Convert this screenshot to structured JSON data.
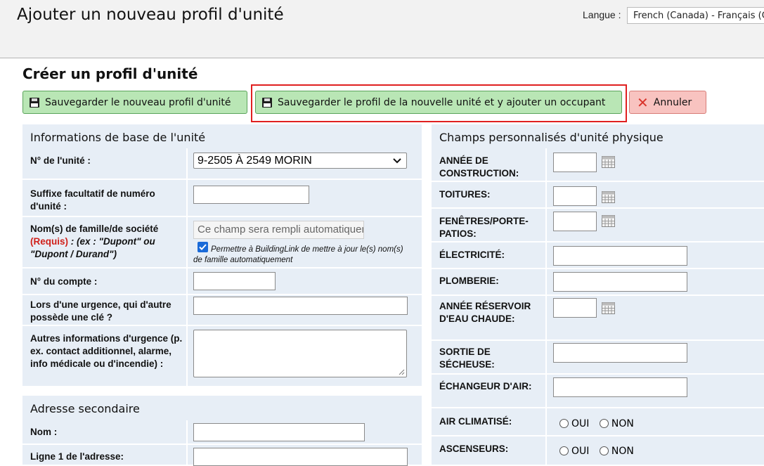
{
  "header": {
    "title": "Ajouter un nouveau profil d'unité",
    "language_label": "Langue :",
    "language_value": "French (Canada) - Français (Canada)"
  },
  "section_title": "Créer un profil d'unité",
  "toolbar": {
    "save_new_label": "Sauvegarder le nouveau profil d'unité",
    "save_add_occupant_label": "Sauvegarder le profil de la nouvelle unité et y ajouter un occupant",
    "cancel_label": "Annuler"
  },
  "basic_info": {
    "heading": "Informations de base de l'unité",
    "unit_number_label": "N° de l'unité :",
    "unit_number_value": "9-2505 À 2549 MORIN",
    "suffix_label": "Suffixe facultatif de numéro d'unité :",
    "family_name_label": "Nom(s) de famille/de société",
    "family_name_required": "(Requis)",
    "family_name_example": " : (ex : \"Dupont\" ou \"Dupont / Durand\")",
    "family_name_placeholder": "Ce champ sera rempli automatiquement",
    "auto_update_label": "Permettre à BuildingLink de mettre à jour le(s) nom(s) de famille automatiquement",
    "account_label": "N° du compte :",
    "key_label": "Lors d'une urgence, qui d'autre possède une clé ?",
    "emergency_label": "Autres informations d'urgence (p. ex. contact additionnel, alarme, info médicale ou d'incendie) :"
  },
  "secondary_address": {
    "heading": "Adresse secondaire",
    "name_label": "Nom :",
    "line1_label": "Ligne 1 de l'adresse:"
  },
  "custom_fields": {
    "heading": "Champs personnalisés d'unité physique",
    "construction_year": "ANNÉE DE CONSTRUCTION:",
    "roofing": "TOITURES:",
    "windows": "FENÊTRES/PORTE-PATIOS:",
    "electricity": "ÉLECTRICITÉ:",
    "plumbing": "PLOMBERIE:",
    "water_heater_year": "ANNÉE RÉSERVOIR D'EAU CHAUDE:",
    "dryer_vent": "SORTIE DE SÉCHEUSE:",
    "air_exchanger": "ÉCHANGEUR D'AIR:",
    "air_conditioning": "AIR CLIMATISÉ:",
    "elevators": "ASCENSEURS:",
    "yes_label": "OUI",
    "no_label": "NON"
  },
  "icons": [
    "floppy-disk-icon",
    "close-icon",
    "calendar-icon",
    "chevron-down-icon",
    "checkbox-checked-icon"
  ],
  "colors": {
    "save_button_bg": "#b9e6b5",
    "cancel_button_bg": "#f8c3c0",
    "highlight_border": "#e02020",
    "panel_bg": "#e7eef6",
    "required_text": "#d0201a"
  }
}
